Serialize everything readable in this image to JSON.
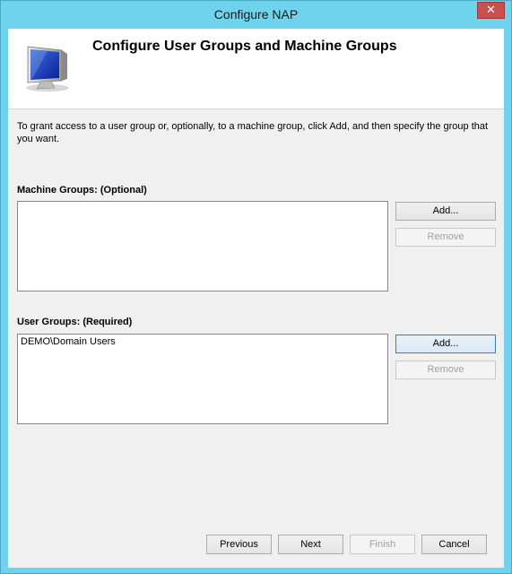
{
  "window": {
    "title": "Configure NAP",
    "close_label": "✕"
  },
  "header": {
    "title": "Configure User Groups and Machine Groups",
    "icon": "computer-monitor-icon"
  },
  "instructions": "To grant access to a user group or, optionally, to a machine group, click Add, and then specify the group that you want.",
  "machine_groups": {
    "label": "Machine Groups: (Optional)",
    "items": [],
    "add_label": "Add...",
    "remove_label": "Remove"
  },
  "user_groups": {
    "label": "User Groups: (Required)",
    "items": [
      "DEMO\\Domain Users"
    ],
    "add_label": "Add...",
    "remove_label": "Remove"
  },
  "footer": {
    "previous_label": "Previous",
    "next_label": "Next",
    "finish_label": "Finish",
    "cancel_label": "Cancel"
  },
  "colors": {
    "frame": "#6fd3ee",
    "close": "#c75050",
    "dialog_bg": "#f0f0f0"
  }
}
